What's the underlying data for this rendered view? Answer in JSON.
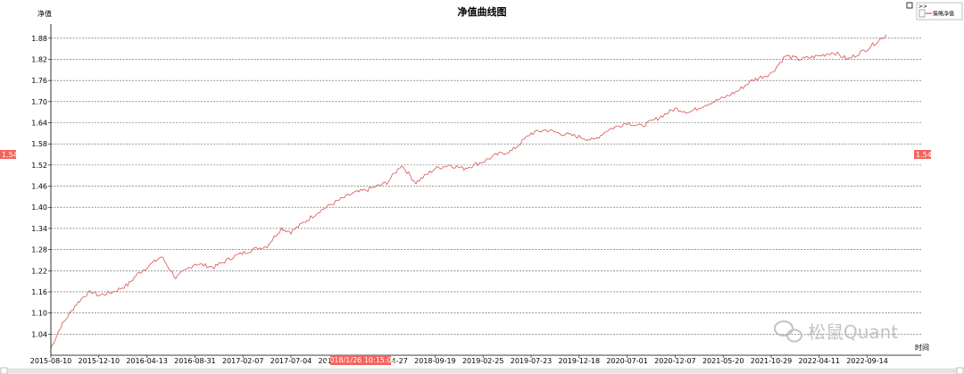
{
  "chart_data": {
    "type": "line",
    "title": "净值曲线图",
    "ylabel": "净值",
    "xlabel": "时间",
    "ylim": [
      0.98,
      1.92
    ],
    "y_ticks": [
      1.04,
      1.1,
      1.16,
      1.22,
      1.28,
      1.34,
      1.4,
      1.46,
      1.52,
      1.58,
      1.64,
      1.7,
      1.76,
      1.82,
      1.88
    ],
    "y_tick_labels": [
      "1.04",
      "1.10",
      "1.16",
      "1.22",
      "1.28",
      "1.34",
      "1.40",
      "1.46",
      "1.52",
      "1.58",
      "1.64",
      "1.70",
      "1.76",
      "1.82",
      "1.88"
    ],
    "x_ticks": [
      "2015-08-10",
      "2015-12-10",
      "2016-04-13",
      "2016-08-31",
      "2017-02-07",
      "2017-07-04",
      "2017-11-28",
      "2018-04-27",
      "2018-09-19",
      "2019-02-25",
      "2019-07-23",
      "2019-12-18",
      "2020-07-01",
      "2020-12-07",
      "2021-05-20",
      "2021-10-29",
      "2022-04-11",
      "2022-09-14"
    ],
    "grid": true,
    "legend_position": "top-right",
    "series": [
      {
        "name": "策略净值",
        "color": "#d9534f",
        "x": [
          0,
          0.1,
          0.2,
          0.35,
          0.5,
          0.7,
          0.85,
          1,
          1.3,
          1.6,
          1.8,
          2,
          2.3,
          2.6,
          3,
          3.4,
          3.8,
          4.2,
          4.5,
          4.8,
          5,
          5.3,
          5.6,
          6,
          6.3,
          6.6,
          7,
          7.3,
          7.6,
          8,
          8.3,
          8.6,
          9,
          9.3,
          9.6,
          10,
          10.3,
          10.6,
          11,
          11.3,
          11.6,
          12,
          12.3,
          12.6,
          13,
          13.3,
          13.6,
          14,
          14.3,
          14.6,
          15,
          15.3,
          15.6,
          16,
          16.3,
          16.6,
          17,
          17.4
        ],
        "values": [
          1.0,
          1.03,
          1.06,
          1.09,
          1.12,
          1.15,
          1.16,
          1.15,
          1.16,
          1.18,
          1.21,
          1.23,
          1.26,
          1.2,
          1.24,
          1.23,
          1.26,
          1.28,
          1.29,
          1.34,
          1.33,
          1.36,
          1.39,
          1.42,
          1.44,
          1.45,
          1.47,
          1.52,
          1.47,
          1.51,
          1.52,
          1.51,
          1.53,
          1.55,
          1.56,
          1.61,
          1.62,
          1.61,
          1.6,
          1.59,
          1.62,
          1.64,
          1.63,
          1.65,
          1.68,
          1.67,
          1.69,
          1.71,
          1.73,
          1.76,
          1.78,
          1.83,
          1.82,
          1.83,
          1.84,
          1.82,
          1.85,
          1.89
        ]
      }
    ],
    "annotations": {
      "y_marker_value": "1.54",
      "x_marker_text": "2018/1/26 10:15:00",
      "x_marker_index": 6.45
    }
  },
  "watermark": "松鼠Quant",
  "legend_toggle": ">>"
}
